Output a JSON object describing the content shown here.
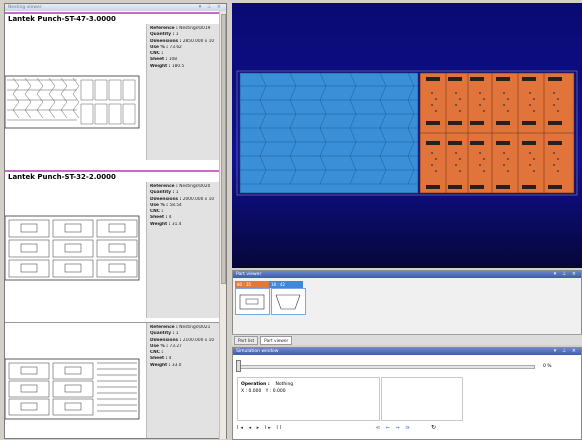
{
  "nesting_viewer": {
    "title": "Nesting viewer",
    "controls": "▾ ⊥ ×",
    "items": [
      {
        "name": "Lantek  Punch-ST-47-3.0000",
        "lines": [
          {
            "k": "Reference : ",
            "v": "Nestings\\0019"
          },
          {
            "k": "Quantity : ",
            "v": "1"
          },
          {
            "k": "Dimensions : ",
            "v": "2850.000 x 10"
          },
          {
            "k": "Use % : ",
            "v": "73.62"
          },
          {
            "k": "CNC : ",
            "v": ""
          },
          {
            "k": "Sheet : ",
            "v": "108"
          },
          {
            "k": "Weight : ",
            "v": "180.5"
          }
        ]
      },
      {
        "name": "Lantek  Punch-ST-32-2.0000",
        "lines": [
          {
            "k": "Reference : ",
            "v": "Nestings\\0020"
          },
          {
            "k": "Quantity : ",
            "v": "1"
          },
          {
            "k": "Dimensions : ",
            "v": "2000.000 x 10"
          },
          {
            "k": "Use % : ",
            "v": "58.54"
          },
          {
            "k": "CNC : ",
            "v": ""
          },
          {
            "k": "Sheet : ",
            "v": "4"
          },
          {
            "k": "Weight : ",
            "v": "31.4"
          }
        ]
      },
      {
        "name": "",
        "lines": [
          {
            "k": "Reference : ",
            "v": "Nestings\\0021"
          },
          {
            "k": "Quantity : ",
            "v": "1"
          },
          {
            "k": "Dimensions : ",
            "v": "2100.000 x 10"
          },
          {
            "k": "Use % : ",
            "v": "73.27"
          },
          {
            "k": "CNC : ",
            "v": ""
          },
          {
            "k": "Sheet : ",
            "v": "4"
          },
          {
            "k": "Weight : ",
            "v": "33.0"
          }
        ]
      }
    ]
  },
  "part_viewer": {
    "title": "Part viewer",
    "controls": "▾ ⊥ ×",
    "tabs": [
      "80 : 35",
      "18 : 42"
    ]
  },
  "bottom_tabs": [
    "Part list",
    "Part viewer"
  ],
  "simulation": {
    "title": "Simulation window",
    "controls": "▾ ⊥ ×",
    "percent": "0 %",
    "operation_label": "Operation :",
    "operation_value": "Nothing",
    "x_label": "X : 0.000",
    "y_label": "Y : 0.000",
    "controls_left": "I◂ ◂ ▸ I▸ II",
    "controls_mid": "⇚ ⇐ ⇒ ⇛"
  },
  "colors": {
    "viewer_bg": "#0a0a72",
    "part_blue": "#3a8fd6",
    "part_orange": "#e0743a",
    "title_blue": "#3d5ea6"
  }
}
